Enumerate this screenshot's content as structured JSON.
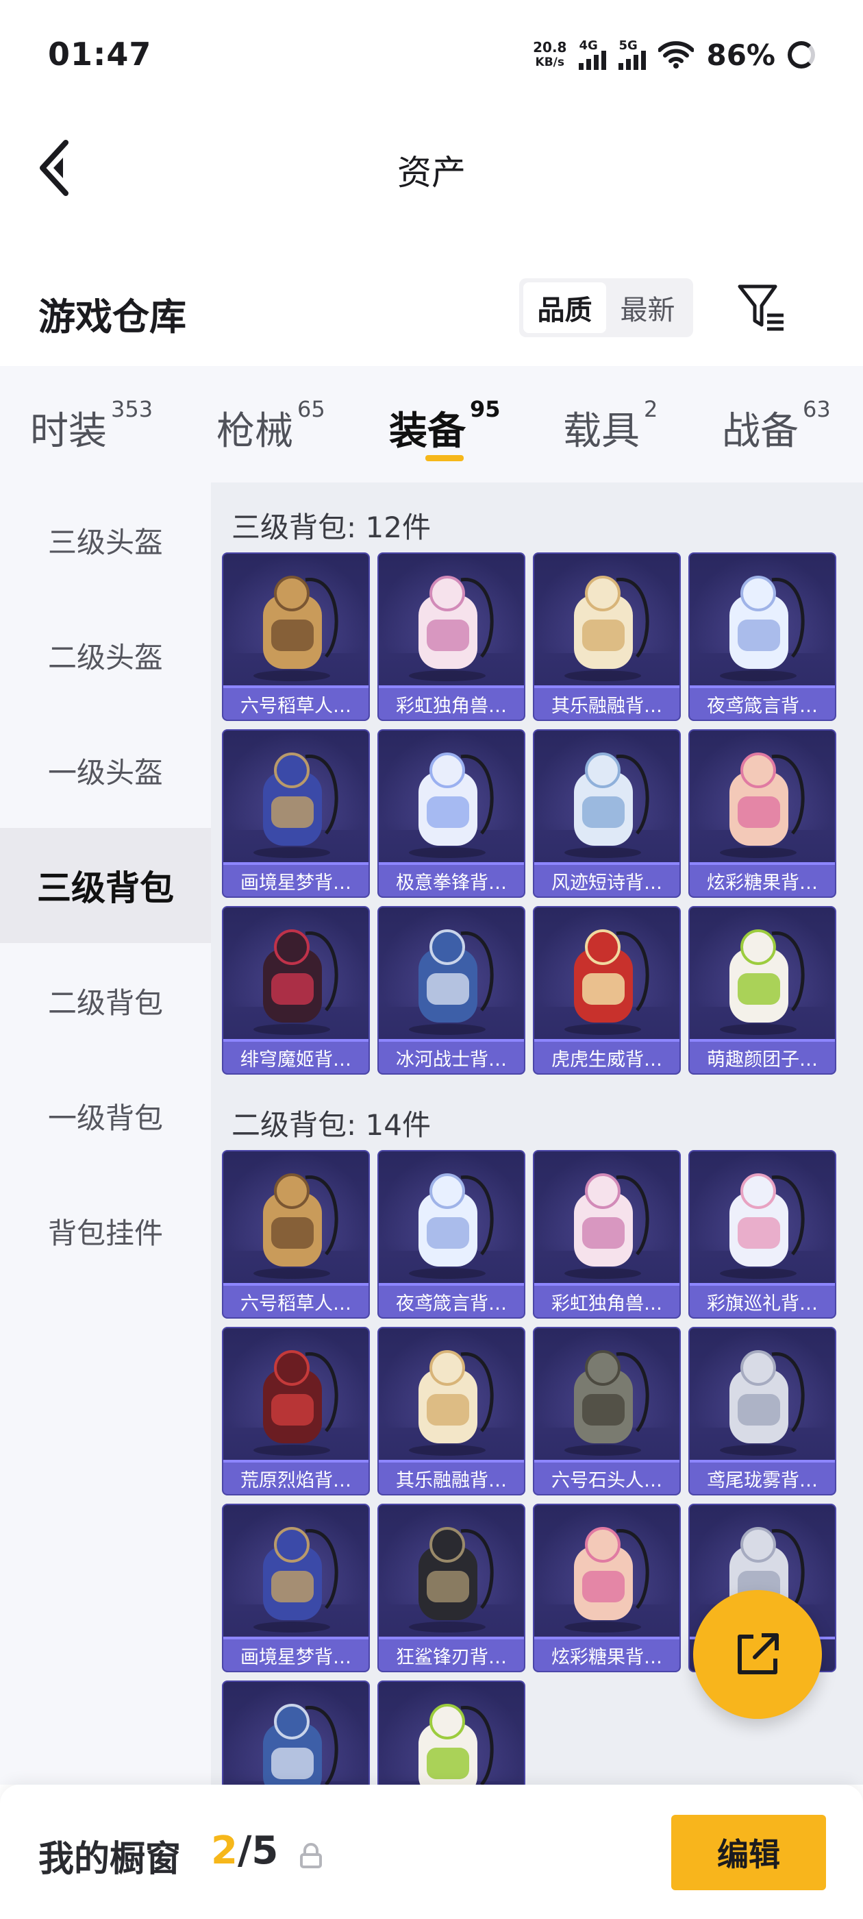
{
  "status_bar": {
    "time": "01:47",
    "net_speed_value": "20.8",
    "net_speed_unit": "KB/s",
    "signal1": "4G",
    "signal2": "5G",
    "battery": "86%"
  },
  "header": {
    "title": "资产"
  },
  "warehouse": {
    "title": "游戏仓库",
    "sort_options": [
      "品质",
      "最新"
    ],
    "active_sort": "品质"
  },
  "tabs": [
    {
      "label": "时装",
      "count": "353"
    },
    {
      "label": "枪械",
      "count": "65"
    },
    {
      "label": "装备",
      "count": "95",
      "active": true
    },
    {
      "label": "载具",
      "count": "2"
    },
    {
      "label": "战备",
      "count": "63"
    }
  ],
  "sidebar": {
    "items": [
      "三级头盔",
      "二级头盔",
      "一级头盔",
      "三级背包",
      "二级背包",
      "一级背包",
      "背包挂件"
    ],
    "active": "三级背包"
  },
  "sections": [
    {
      "title": "三级背包: 12件",
      "items": [
        {
          "name": "六号稻草人…",
          "icon": "scarecrow-backpack"
        },
        {
          "name": "彩虹独角兽…",
          "icon": "unicorn-backpack"
        },
        {
          "name": "其乐融融背…",
          "icon": "cream-backpack"
        },
        {
          "name": "夜鸢箴言背…",
          "icon": "jellyfish-backpack"
        },
        {
          "name": "画境星梦背…",
          "icon": "mirror-backpack"
        },
        {
          "name": "极意拳锋背…",
          "icon": "cake-backpack"
        },
        {
          "name": "风迹短诗背…",
          "icon": "box-backpack"
        },
        {
          "name": "炫彩糖果背…",
          "icon": "donut-backpack"
        },
        {
          "name": "绯穹魔姬背…",
          "icon": "bat-backpack"
        },
        {
          "name": "冰河战士背…",
          "icon": "blue-backpack"
        },
        {
          "name": "虎虎生威背…",
          "icon": "red-backpack"
        },
        {
          "name": "萌趣颜团子…",
          "icon": "dumpling-backpack"
        }
      ]
    },
    {
      "title": "二级背包: 14件",
      "items": [
        {
          "name": "六号稻草人…",
          "icon": "scarecrow-backpack"
        },
        {
          "name": "夜鸢箴言背…",
          "icon": "jellyfish-backpack"
        },
        {
          "name": "彩虹独角兽…",
          "icon": "unicorn-backpack"
        },
        {
          "name": "彩旗巡礼背…",
          "icon": "bow-backpack"
        },
        {
          "name": "荒原烈焰背…",
          "icon": "flame-backpack"
        },
        {
          "name": "其乐融融背…",
          "icon": "cream-backpack"
        },
        {
          "name": "六号石头人…",
          "icon": "stone-backpack"
        },
        {
          "name": "鸢尾珑雾背…",
          "icon": "pouch-backpack"
        },
        {
          "name": "画境星梦背…",
          "icon": "mirror-backpack"
        },
        {
          "name": "狂鲨锋刃背…",
          "icon": "shark-backpack"
        },
        {
          "name": "炫彩糖果背…",
          "icon": "donut-backpack"
        },
        {
          "name": "",
          "icon": "pouch-backpack"
        },
        {
          "name": "",
          "icon": "blue-backpack"
        },
        {
          "name": "",
          "icon": "dumpling-backpack"
        }
      ]
    }
  ],
  "bottom_bar": {
    "label": "我的橱窗",
    "current": "2",
    "separator": "/",
    "total": "5",
    "edit": "编辑"
  },
  "colors": {
    "accent": "#f8b51c",
    "card_bg": "#2d2a66",
    "card_label": "#6a63d0"
  }
}
